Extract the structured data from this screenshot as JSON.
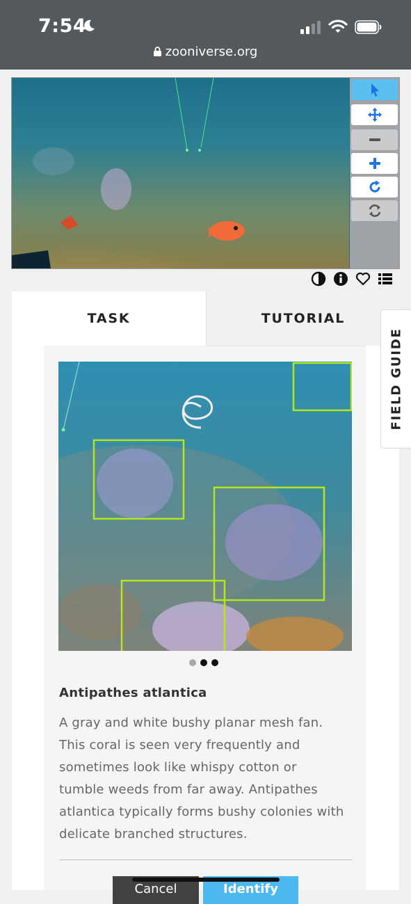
{
  "status_bar": {
    "time": "7:54",
    "url": "zooniverse.org"
  },
  "viewer": {
    "tools": [
      "pointer-icon",
      "move-icon",
      "zoom-out-icon",
      "zoom-in-icon",
      "rotate-icon",
      "reset-icon"
    ],
    "actions": [
      "contrast-icon",
      "info-icon",
      "heart-icon",
      "list-icon"
    ]
  },
  "tabs": {
    "task": "TASK",
    "tutorial": "TUTORIAL"
  },
  "field_guide": {
    "label": "FIELD GUIDE",
    "species_name": "Antipathes atlantica",
    "description": "A gray and white bushy planar mesh fan. This coral is seen very frequently and sometimes look like whispy cotton or tumble weeds from far away. Antipathes atlantica typically forms bushy colonies with delicate branched structures.",
    "carousel": {
      "count": 3,
      "active": 2
    }
  },
  "buttons": {
    "cancel": "Cancel",
    "identify": "Identify"
  },
  "colors": {
    "accent": "#4bb8ef",
    "dark": "#404244",
    "box": "#b5e61d"
  }
}
